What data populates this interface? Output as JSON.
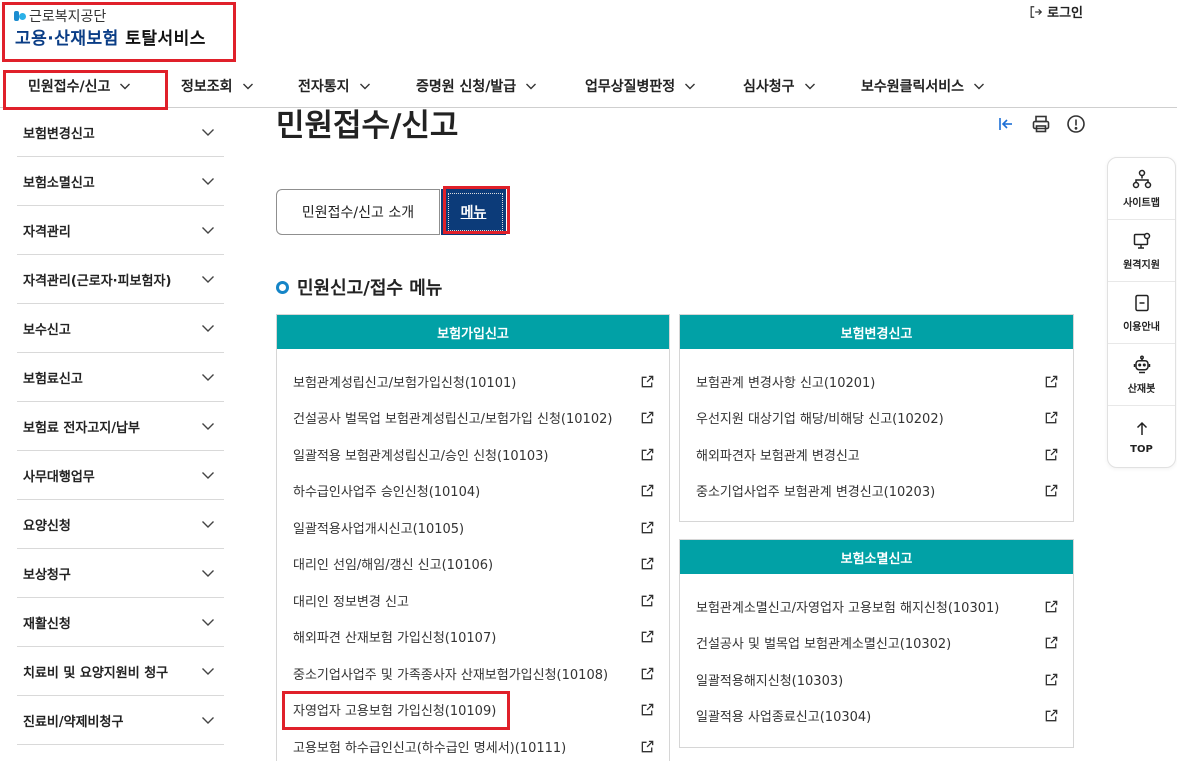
{
  "header": {
    "org_name": "근로복지공단",
    "service_name_blue": "고용·산재보험",
    "service_name_dark": "토탈서비스",
    "login_label": "로그인"
  },
  "topnav": {
    "items": [
      {
        "label": "민원접수/신고"
      },
      {
        "label": "정보조회"
      },
      {
        "label": "전자통지"
      },
      {
        "label": "증명원 신청/발급"
      },
      {
        "label": "업무상질병판정"
      },
      {
        "label": "심사청구"
      },
      {
        "label": "보수원클릭서비스"
      }
    ]
  },
  "sidebar": {
    "items": [
      {
        "label": "보험변경신고"
      },
      {
        "label": "보험소멸신고"
      },
      {
        "label": "자격관리"
      },
      {
        "label": "자격관리(근로자·피보험자)"
      },
      {
        "label": "보수신고"
      },
      {
        "label": "보험료신고"
      },
      {
        "label": "보험료 전자고지/납부"
      },
      {
        "label": "사무대행업무"
      },
      {
        "label": "요양신청"
      },
      {
        "label": "보상청구"
      },
      {
        "label": "재활신청"
      },
      {
        "label": "치료비 및 요양지원비 청구"
      },
      {
        "label": "진료비/약제비청구"
      }
    ]
  },
  "main": {
    "page_title": "민원접수/신고",
    "tab_intro": "민원접수/신고 소개",
    "tab_menu": "메뉴",
    "section_title": "민원신고/접수 메뉴"
  },
  "panels": {
    "join": {
      "title": "보험가입신고",
      "items": [
        "보험관계성립신고/보험가입신청(10101)",
        "건설공사 벌목업 보험관계성립신고/보험가입 신청(10102)",
        "일괄적용 보험관계성립신고/승인 신청(10103)",
        "하수급인사업주 승인신청(10104)",
        "일괄적용사업개시신고(10105)",
        "대리인 선임/해임/갱신 신고(10106)",
        "대리인 정보변경 신고",
        "해외파견 산재보험 가입신청(10107)",
        "중소기업사업주 및 가족종사자 산재보험가입신청(10108)",
        "자영업자 고용보험 가입신청(10109)",
        "고용보험 하수급인신고(하수급인 명세서)(10111)"
      ]
    },
    "change": {
      "title": "보험변경신고",
      "items": [
        "보험관계 변경사항 신고(10201)",
        "우선지원 대상기업 해당/비해당 신고(10202)",
        "해외파견자 보험관계 변경신고",
        "중소기업사업주 보험관계 변경신고(10203)"
      ]
    },
    "terminate": {
      "title": "보험소멸신고",
      "items": [
        "보험관계소멸신고/자영업자 고용보험 해지신청(10301)",
        "건설공사 및 벌목업 보험관계소멸신고(10302)",
        "일괄적용해지신청(10303)",
        "일괄적용 사업종료신고(10304)"
      ]
    }
  },
  "quick_menu": {
    "items": [
      {
        "label": "사이트맵"
      },
      {
        "label": "원격지원"
      },
      {
        "label": "이용안내"
      },
      {
        "label": "산재봇"
      },
      {
        "label": "TOP"
      }
    ]
  },
  "colors": {
    "brand_navy": "#0c3b79",
    "panel_teal": "#01a1a6",
    "annotation_red": "#e0202a",
    "accent_blue": "#1585c7"
  }
}
